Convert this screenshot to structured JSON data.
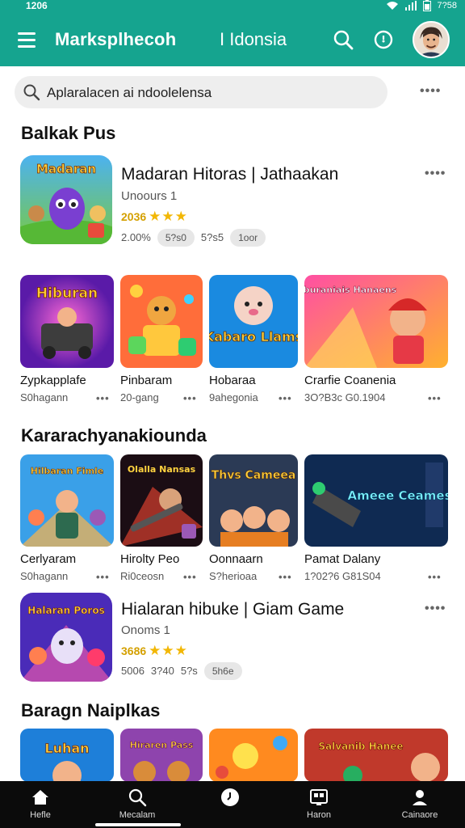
{
  "status": {
    "time": "1206",
    "battery": "7?58"
  },
  "appbar": {
    "title": "Marksplhecoh",
    "region": "I Idonsia"
  },
  "search": {
    "placeholder": "Aplaralacen ai ndoolelensa"
  },
  "sections": [
    {
      "title": "Balkak Pus"
    },
    {
      "title": "Kararachyanakiounda"
    },
    {
      "title": "Baragn Naiplkas"
    }
  ],
  "featured": [
    {
      "title": "Madaran Hitoras | Jathaakan",
      "subtitle": "Unoours 1",
      "rating": "2036",
      "meta": [
        "2.00%",
        "5?s0",
        "5?s5",
        "1oor"
      ],
      "art_label": "Madaran"
    },
    {
      "title": "Hialaran hibuke | Giam Game",
      "subtitle": "Onoms 1",
      "rating": "3686",
      "meta": [
        "5006",
        "3?40",
        "5?s",
        "5h6e"
      ],
      "art_label": "Halaran Poros"
    }
  ],
  "row1": [
    {
      "name": "Zypkapplafe",
      "sub": "S0hagann",
      "art_label": "Hiburan"
    },
    {
      "name": "Pinbaram",
      "sub": "20-gang",
      "art_label": ""
    },
    {
      "name": "Hobaraa",
      "sub": "9ahegonia",
      "art_label": "Kabaro Llams"
    },
    {
      "name": "Crarfie Coanenia",
      "sub": "3O?B3c G0.1904",
      "art_label": "Hiburaniais Hanaens"
    }
  ],
  "row2": [
    {
      "name": "Cerlyaram",
      "sub": "S0hagann",
      "art_label": "Hilbaran Fimle"
    },
    {
      "name": "Hirolty Peo",
      "sub": "Ri0ceosn",
      "art_label": "Olalla Nansas"
    },
    {
      "name": "Oonnaarn",
      "sub": "S?herioaa",
      "art_label": "Thvs Cameea"
    },
    {
      "name": "Pamat Dalany",
      "sub": "1?02?6 G81S04",
      "art_label": "Ameee Ceames"
    }
  ],
  "row3": [
    {
      "art_label": "Luhan"
    },
    {
      "art_label": "Hiraren Pass"
    },
    {
      "art_label": ""
    },
    {
      "art_label": "Salvanib Hanee"
    }
  ],
  "nav": [
    {
      "label": "Hefle",
      "icon": "home-icon"
    },
    {
      "label": "Mecalam",
      "icon": "search-icon"
    },
    {
      "label": "",
      "icon": "games-icon"
    },
    {
      "label": "Haron",
      "icon": "apps-icon"
    },
    {
      "label": "Cainaore",
      "icon": "account-icon"
    }
  ],
  "colors": {
    "primary": "#15a48f",
    "star": "#f2b705",
    "nav_bg": "#0b0b0b"
  }
}
